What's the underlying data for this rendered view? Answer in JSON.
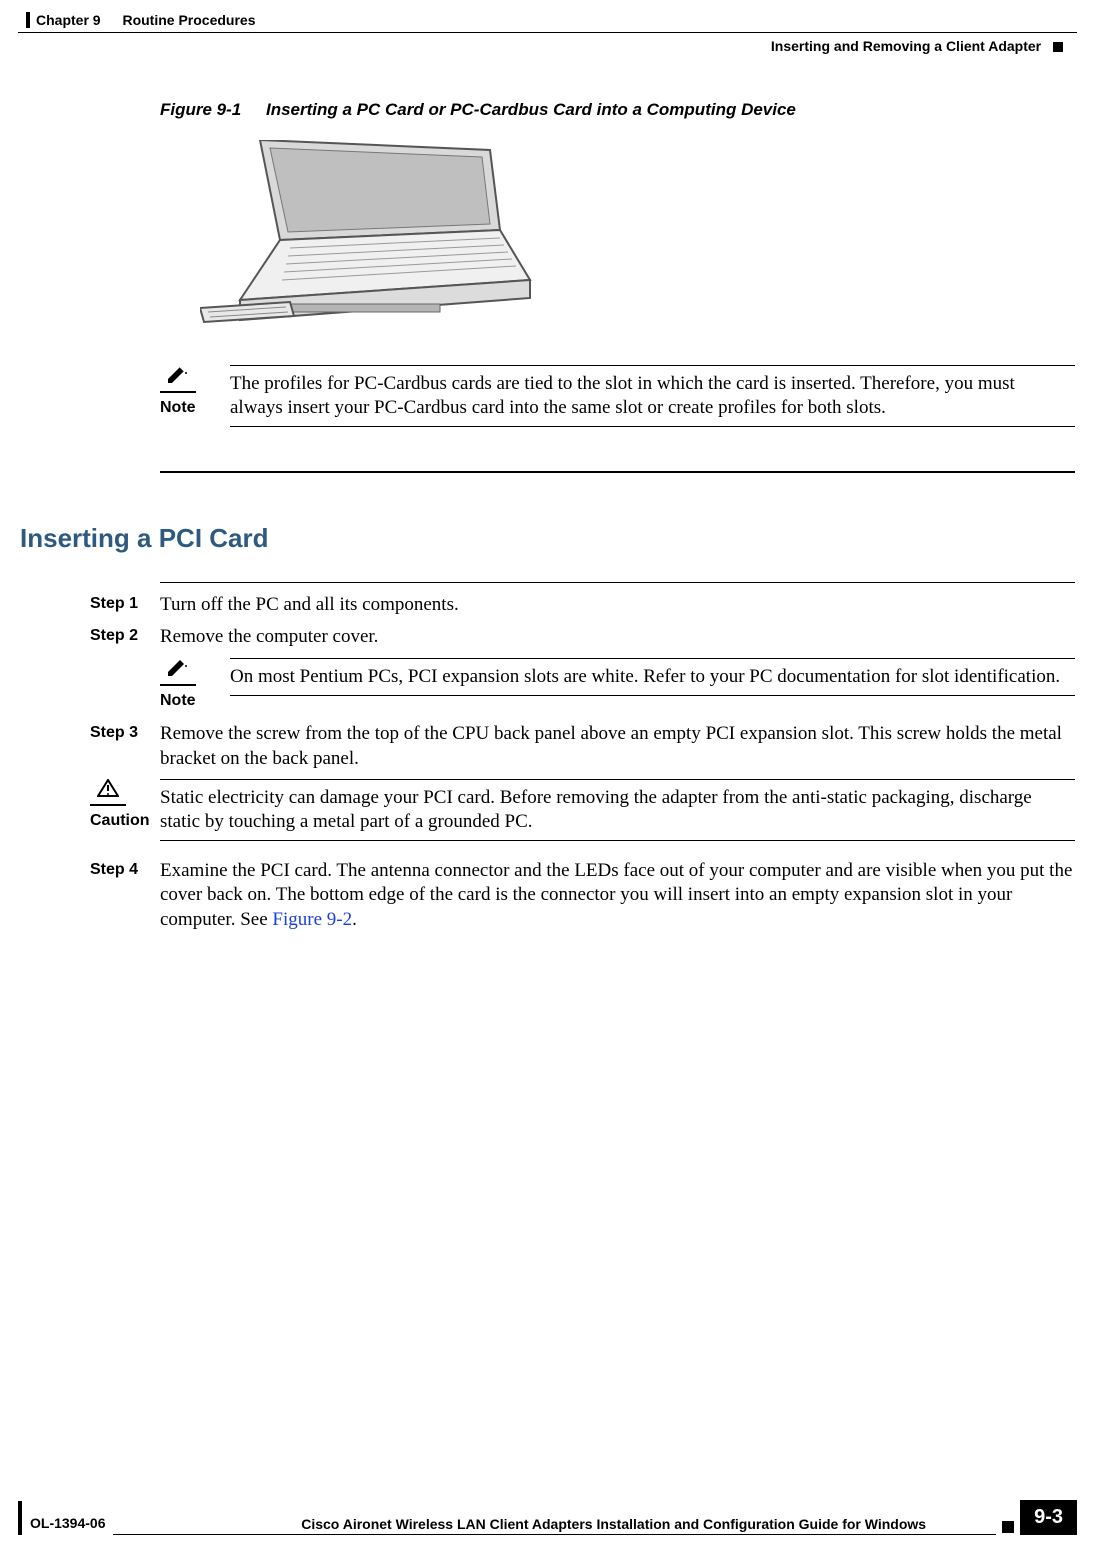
{
  "header": {
    "chapter": "Chapter 9",
    "chapter_title": "Routine Procedures",
    "section": "Inserting and Removing a Client Adapter"
  },
  "figure": {
    "label": "Figure 9-1",
    "title": "Inserting a PC Card or PC-Cardbus Card into a Computing Device"
  },
  "note1": {
    "label": "Note",
    "text": "The profiles for PC-Cardbus cards are tied to the slot in which the card is inserted. Therefore, you must always insert your PC-Cardbus card into the same slot or create profiles for both slots."
  },
  "section_heading": "Inserting a PCI Card",
  "steps": {
    "s1": {
      "label": "Step 1",
      "text": "Turn off the PC and all its components."
    },
    "s2": {
      "label": "Step 2",
      "text": "Remove the computer cover."
    },
    "s2note": {
      "label": "Note",
      "text": "On most Pentium PCs, PCI expansion slots are white. Refer to your PC documentation for slot identification."
    },
    "s3": {
      "label": "Step 3",
      "text": "Remove the screw from the top of the CPU back panel above an empty PCI expansion slot. This screw holds the metal bracket on the back panel."
    },
    "caution": {
      "label": "Caution",
      "text": "Static electricity can damage your PCI card. Before removing the adapter from the anti-static packaging, discharge static by touching a metal part of a grounded PC."
    },
    "s4": {
      "label": "Step 4",
      "pre": "Examine the PCI card. The antenna connector and the LEDs face out of your computer and are visible when you put the cover back on. The bottom edge of the card is the connector you will insert into an empty expansion slot in your computer. See ",
      "link": "Figure 9-2",
      "post": "."
    }
  },
  "footer": {
    "doc_id": "OL-1394-06",
    "guide": "Cisco Aironet Wireless LAN Client Adapters Installation and Configuration Guide for Windows",
    "page": "9-3"
  }
}
